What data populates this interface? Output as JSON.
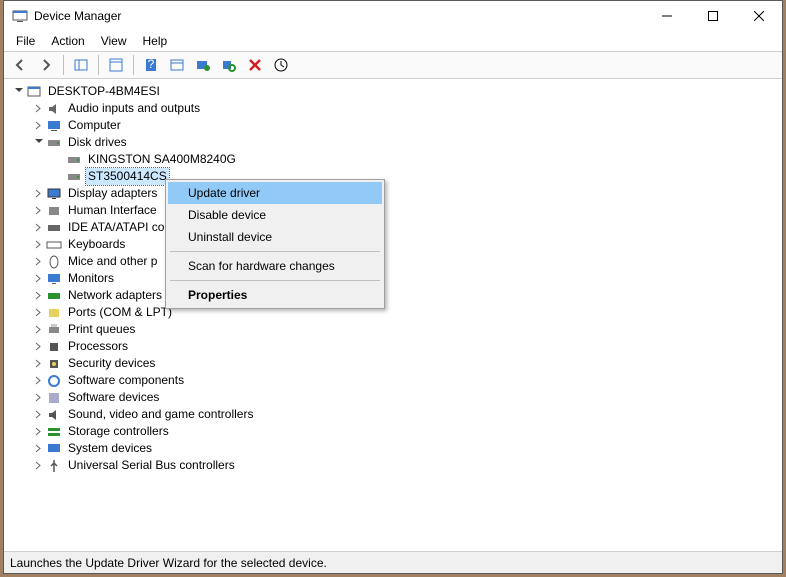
{
  "window": {
    "title": "Device Manager"
  },
  "menubar": {
    "file": "File",
    "action": "Action",
    "view": "View",
    "help": "Help"
  },
  "toolbar_icons": [
    "back",
    "forward",
    "show-hide",
    "properties",
    "help",
    "action-center",
    "update-drivers",
    "scan",
    "uninstall",
    "more"
  ],
  "tree": {
    "root": {
      "label": "DESKTOP-4BM4ESI",
      "expanded": true
    },
    "nodes": [
      {
        "label": "Audio inputs and outputs",
        "icon": "audio",
        "chev": true
      },
      {
        "label": "Computer",
        "icon": "computer",
        "chev": true
      },
      {
        "label": "Disk drives",
        "icon": "disk",
        "chev": true,
        "expanded": true,
        "children": [
          {
            "label": "KINGSTON SA400M8240G",
            "icon": "disk"
          },
          {
            "label": "ST3500414CS",
            "icon": "disk",
            "selected": true
          }
        ]
      },
      {
        "label": "Display adapters",
        "icon": "display",
        "chev": true
      },
      {
        "label": "Human Interface Devices",
        "icon": "hid",
        "chev": true,
        "clipped": "Human Interface"
      },
      {
        "label": "IDE ATA/ATAPI controllers",
        "icon": "ide",
        "chev": true,
        "clipped": "IDE ATA/ATAPI co"
      },
      {
        "label": "Keyboards",
        "icon": "keyboard",
        "chev": true
      },
      {
        "label": "Mice and other pointing devices",
        "icon": "mouse",
        "chev": true,
        "clipped": "Mice and other p"
      },
      {
        "label": "Monitors",
        "icon": "monitor",
        "chev": true
      },
      {
        "label": "Network adapters",
        "icon": "network",
        "chev": true,
        "clipped": "Network adapters"
      },
      {
        "label": "Ports (COM & LPT)",
        "icon": "port",
        "chev": true
      },
      {
        "label": "Print queues",
        "icon": "printer",
        "chev": true
      },
      {
        "label": "Processors",
        "icon": "cpu",
        "chev": true
      },
      {
        "label": "Security devices",
        "icon": "security",
        "chev": true
      },
      {
        "label": "Software components",
        "icon": "swcomp",
        "chev": true
      },
      {
        "label": "Software devices",
        "icon": "swdev",
        "chev": true
      },
      {
        "label": "Sound, video and game controllers",
        "icon": "sound",
        "chev": true
      },
      {
        "label": "Storage controllers",
        "icon": "storage",
        "chev": true
      },
      {
        "label": "System devices",
        "icon": "system",
        "chev": true
      },
      {
        "label": "Universal Serial Bus controllers",
        "icon": "usb",
        "chev": true
      }
    ]
  },
  "context_menu": {
    "items": [
      {
        "label": "Update driver",
        "highlighted": true
      },
      {
        "label": "Disable device"
      },
      {
        "label": "Uninstall device"
      },
      {
        "sep": true
      },
      {
        "label": "Scan for hardware changes"
      },
      {
        "sep": true
      },
      {
        "label": "Properties",
        "bold": true
      }
    ]
  },
  "statusbar": {
    "text": "Launches the Update Driver Wizard for the selected device."
  }
}
